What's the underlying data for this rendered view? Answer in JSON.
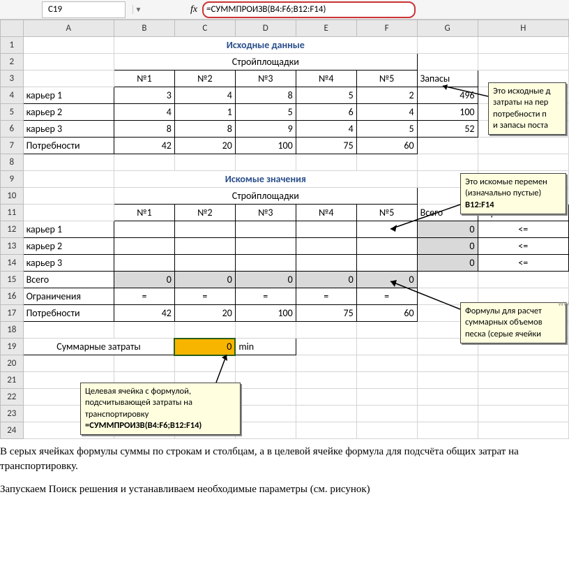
{
  "name_box": "C19",
  "fx_label": "fx",
  "formula": "=СУММПРОИЗВ(B4:F6;B12:F14)",
  "colHeaders": [
    "A",
    "B",
    "C",
    "D",
    "E",
    "F",
    "G",
    "H"
  ],
  "rowNumbers": [
    "1",
    "2",
    "3",
    "4",
    "5",
    "6",
    "7",
    "8",
    "9",
    "10",
    "11",
    "12",
    "13",
    "14",
    "15",
    "16",
    "17",
    "18",
    "19",
    "20",
    "21",
    "22",
    "23",
    "24"
  ],
  "titles": {
    "src": "Исходные данные",
    "seek": "Искомые значения"
  },
  "labels": {
    "sites": "Стройплощадки",
    "n1": "№1",
    "n2": "№2",
    "n3": "№3",
    "n4": "№4",
    "n5": "№5",
    "zapasy": "Запасы",
    "k1": "карьер 1",
    "k2": "карьер 2",
    "k3": "карьер 3",
    "potreb": "Потребности",
    "vsego": "Всего",
    "ogran": "Ограничения",
    "sumz": "Суммарные затраты",
    "min": "min",
    "le": "<=",
    "eq": "="
  },
  "src": {
    "r4": {
      "b": "3",
      "c": "4",
      "d": "8",
      "e": "5",
      "f": "2",
      "g": "496"
    },
    "r5": {
      "b": "4",
      "c": "1",
      "d": "5",
      "e": "6",
      "f": "4",
      "g": "100"
    },
    "r6": {
      "b": "8",
      "c": "8",
      "d": "9",
      "e": "4",
      "f": "5",
      "g": "52"
    },
    "r7": {
      "b": "42",
      "c": "20",
      "d": "100",
      "e": "75",
      "f": "60"
    }
  },
  "seek": {
    "g12": "0",
    "g13": "0",
    "g14": "0",
    "r15": {
      "b": "0",
      "c": "0",
      "d": "0",
      "e": "0",
      "f": "0"
    },
    "r17": {
      "b": "42",
      "c": "20",
      "d": "100",
      "e": "75",
      "f": "60"
    }
  },
  "c19_val": "0",
  "callouts": {
    "c1_l1": "Это исходные д",
    "c1_l2": "затраты на пер",
    "c1_l3": "потребности п",
    "c1_l4": "и запасы поста",
    "c2_l1": "Это искомые перемен",
    "c2_l2": "(изначально пустые)",
    "c2_l3": "B12:F14",
    "c3_l1": "Формулы для расчет",
    "c3_l2": "суммарных объемов",
    "c3_l3": "песка (серые ячейки",
    "c4_l1": "Целевая ячейка с формулой,",
    "c4_l2": "подсчитывающей затраты на",
    "c4_l3": "транспортировку",
    "c4_l4": "=СУММПРОИЗВ(B4:F6;B12:F14)"
  },
  "footer": {
    "p1": "В серых ячейках формулы суммы по строкам и столбцам, а в целевой ячейке формула для подсчёта общих затрат на транспортировку.",
    "p2": "Запускаем Поиск решения и устанавливаем необходимые параметры (см. рисунок)"
  },
  "www": "ww"
}
